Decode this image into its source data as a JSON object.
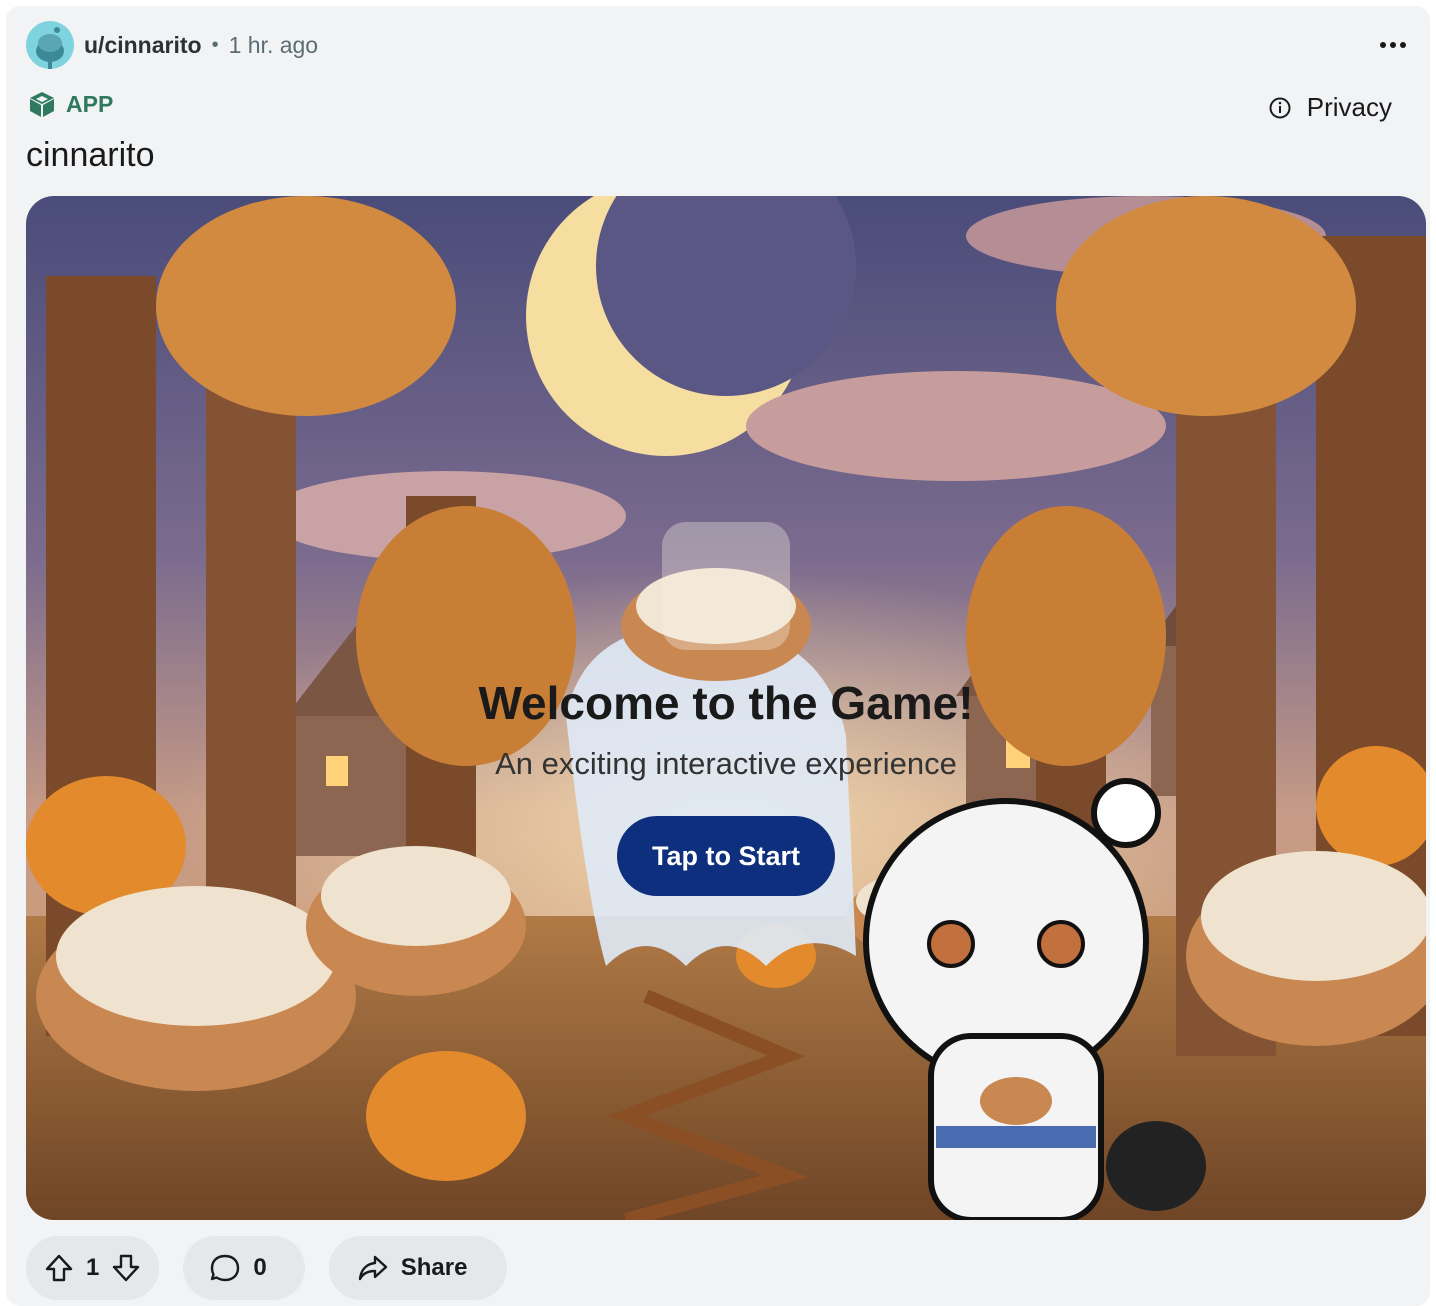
{
  "post": {
    "username": "u/cinnarito",
    "separator": "•",
    "time": "1 hr. ago",
    "app_label": "APP",
    "privacy_label": "Privacy",
    "title": "cinnarito"
  },
  "game": {
    "welcome": "Welcome to the Game!",
    "subtitle": "An exciting interactive experience",
    "start_button": "Tap to Start"
  },
  "actions": {
    "upvotes": "1",
    "comments": "0",
    "share_label": "Share"
  },
  "icons": [
    "snoo-avatar-icon",
    "more-icon",
    "app-cube-icon",
    "info-icon",
    "upvote-icon",
    "downvote-icon",
    "comment-icon",
    "share-icon"
  ],
  "colors": {
    "accent": "#0d2f7d",
    "app_green": "#2f7a5e",
    "card_bg": "#f1f3f5"
  }
}
